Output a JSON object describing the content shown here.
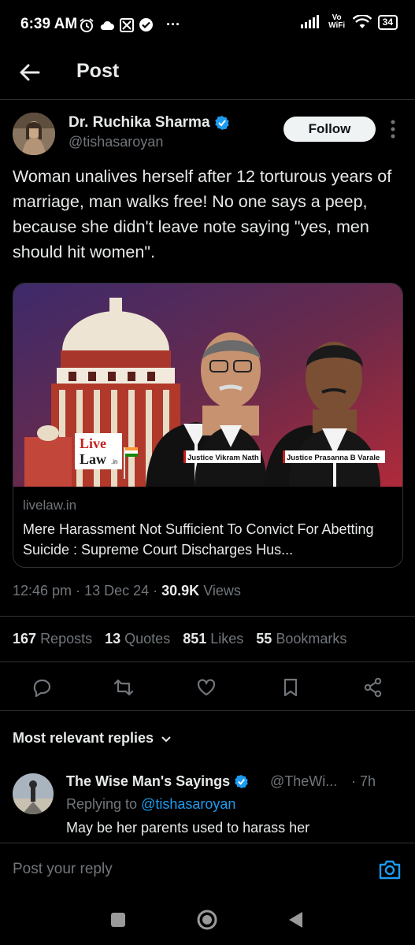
{
  "status_bar": {
    "time": "6:39 AM",
    "icons": [
      "alarm-icon",
      "cloud-icon",
      "app-notification-icon",
      "check-badge-icon"
    ],
    "more": "···",
    "network": "Vo WiFi",
    "battery": "34"
  },
  "header": {
    "title": "Post"
  },
  "post": {
    "author_name": "Dr. Ruchika Sharma",
    "author_handle": "@tishasaroyan",
    "follow_label": "Follow",
    "text": "Woman unalives herself after 12 torturous years of marriage, man walks free! No one says a peep, because she didn't leave note saying \"yes, men should hit women\".",
    "card": {
      "image_labels": {
        "logo_line1": "Live",
        "logo_line2": "Law",
        "logo_suffix": ".in",
        "judge1": "Justice Vikram Nath",
        "judge2": "Justice Prasanna B Varale"
      },
      "domain": "livelaw.in",
      "title": "Mere Harassment Not Sufficient To Convict For Abetting Suicide : Supreme Court Discharges Hus..."
    },
    "time": "12:46 pm",
    "date": "13 Dec 24",
    "views_count": "30.9K",
    "views_label": "Views",
    "stats": {
      "reposts_count": "167",
      "reposts_label": "Reposts",
      "quotes_count": "13",
      "quotes_label": "Quotes",
      "likes_count": "851",
      "likes_label": "Likes",
      "bookmarks_count": "55",
      "bookmarks_label": "Bookmarks"
    }
  },
  "replies": {
    "heading": "Most relevant replies",
    "items": [
      {
        "name": "The Wise Man's Sayings",
        "handle": "@TheWi...",
        "time": "· 7h",
        "replying_prefix": "Replying to",
        "replying_to": "@tishasaroyan",
        "text": "May be her parents used to harass her"
      }
    ]
  },
  "compose": {
    "placeholder": "Post your reply"
  },
  "colors": {
    "background": "#000000",
    "text_primary": "#e7e9ea",
    "text_secondary": "#71767b",
    "accent": "#1d9bf0",
    "divider": "#2f3336"
  }
}
